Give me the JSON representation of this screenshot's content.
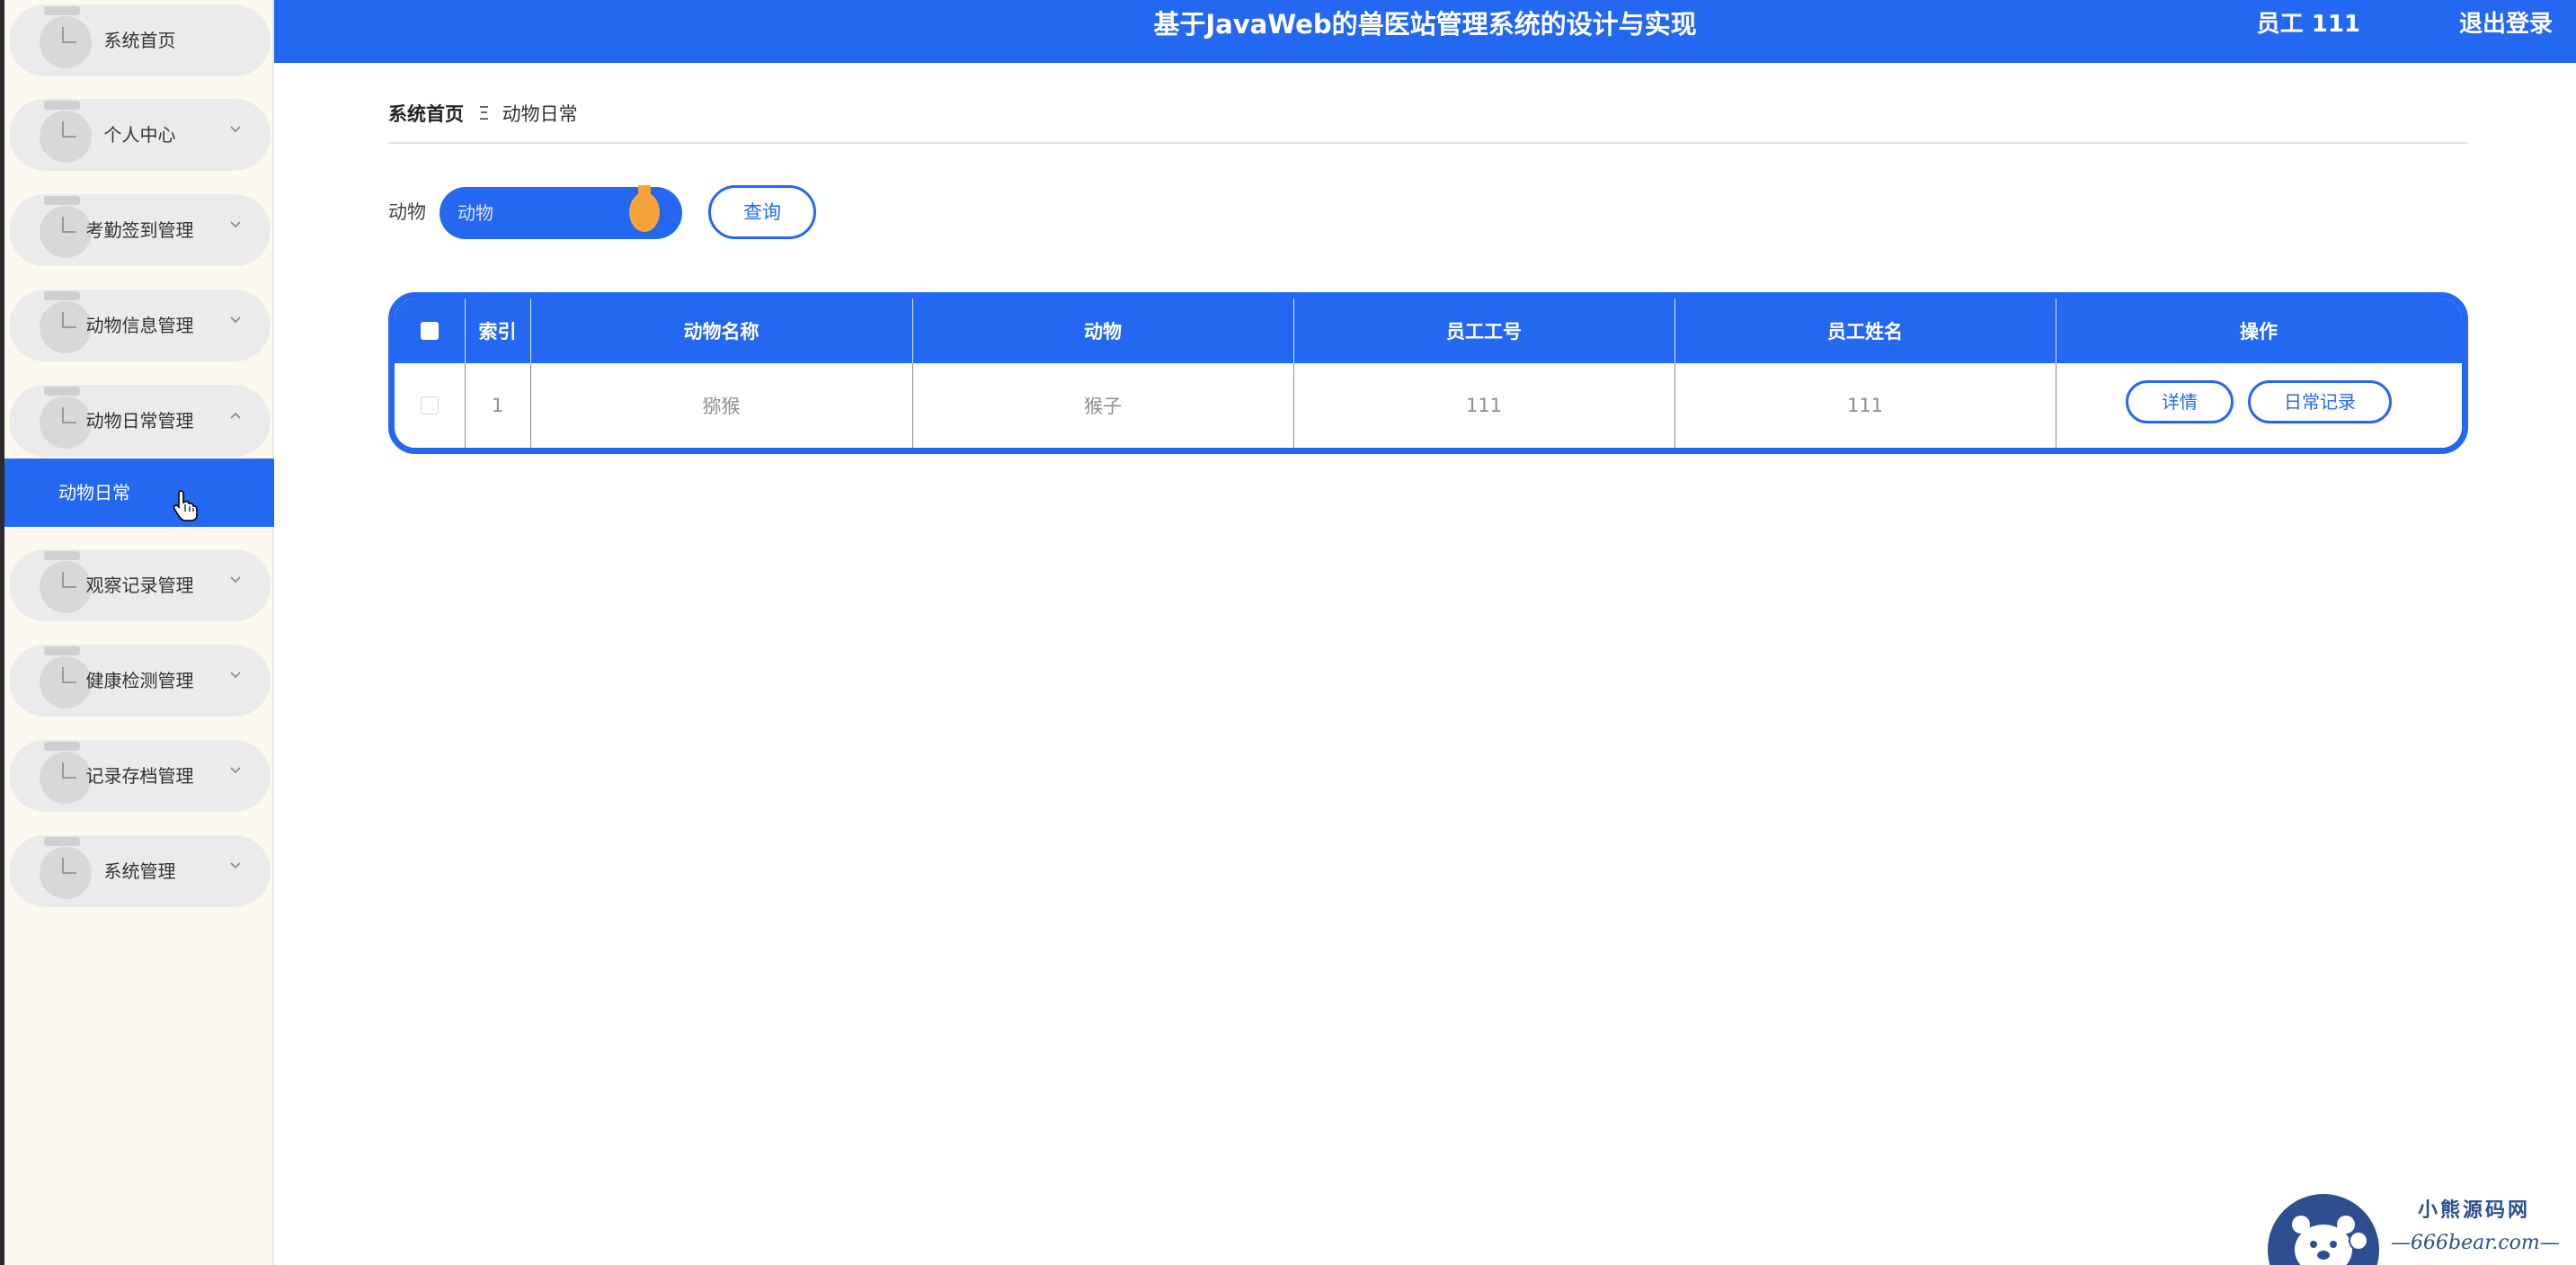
{
  "header": {
    "title": "基于JavaWeb的兽医站管理系统的设计与实现",
    "user": "员工 111",
    "logout": "退出登录"
  },
  "sidebar": {
    "items": [
      {
        "label": "系统首页",
        "has_arrow": false
      },
      {
        "label": "个人中心",
        "has_arrow": true,
        "expanded": false
      },
      {
        "label": "考勤签到管理",
        "has_arrow": true,
        "expanded": false
      },
      {
        "label": "动物信息管理",
        "has_arrow": true,
        "expanded": false
      },
      {
        "label": "动物日常管理",
        "has_arrow": true,
        "expanded": true
      },
      {
        "label": "观察记录管理",
        "has_arrow": true,
        "expanded": false
      },
      {
        "label": "健康检测管理",
        "has_arrow": true,
        "expanded": false
      },
      {
        "label": "记录存档管理",
        "has_arrow": true,
        "expanded": false
      },
      {
        "label": "系统管理",
        "has_arrow": true,
        "expanded": false
      }
    ],
    "active_sub": "动物日常"
  },
  "breadcrumb": {
    "home": "系统首页",
    "separator": "Ξ",
    "current": "动物日常"
  },
  "search": {
    "label": "动物",
    "placeholder": "动物",
    "button": "查询"
  },
  "table": {
    "headers": [
      "索引",
      "动物名称",
      "动物",
      "员工工号",
      "员工姓名",
      "操作"
    ],
    "rows": [
      {
        "index": "1",
        "animal_name": "猕猴",
        "animal": "猴子",
        "employee_id": "111",
        "employee_name": "111",
        "actions": [
          "详情",
          "日常记录"
        ]
      }
    ]
  },
  "watermark": {
    "name": "小熊源码网",
    "url": "—666bear.com—"
  },
  "colors": {
    "primary": "#2468f2",
    "sidebar_bg": "#fdf9f0",
    "menu_item_bg": "#ebebeb",
    "knob": "#f5a33a"
  }
}
